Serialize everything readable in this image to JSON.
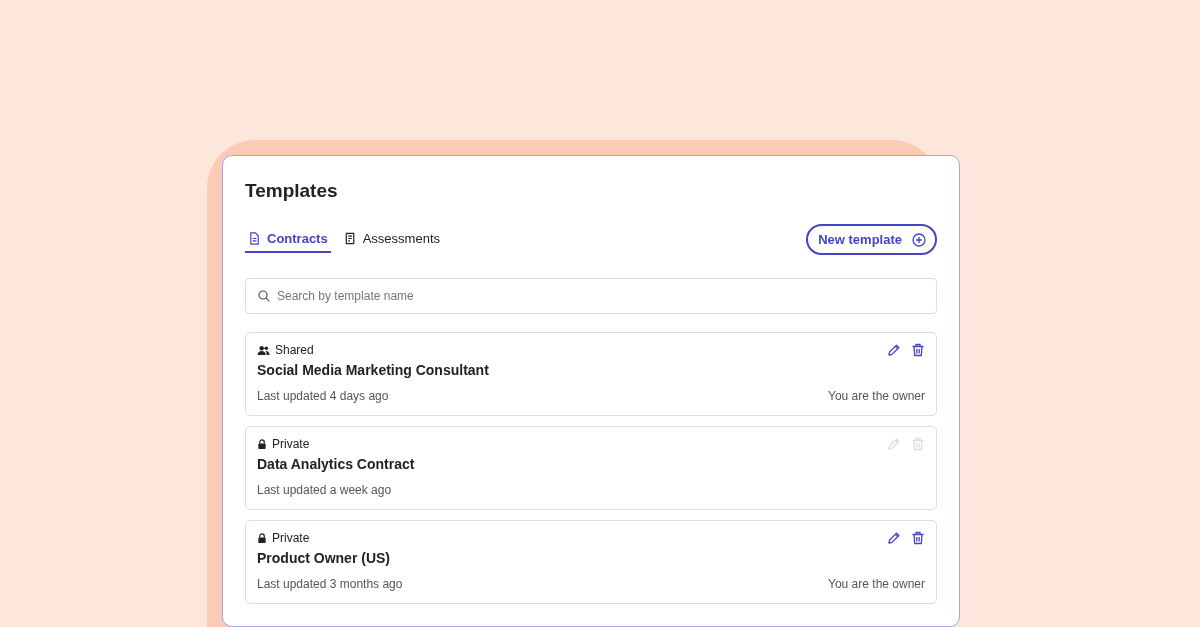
{
  "title": "Templates",
  "tabs": [
    {
      "label": "Contracts",
      "kind": "document",
      "selected": true
    },
    {
      "label": "Assessments",
      "kind": "checklist",
      "selected": false
    }
  ],
  "new_button": {
    "label": "New template"
  },
  "search": {
    "placeholder": "Search by template name"
  },
  "templates": [
    {
      "visibility": "Shared",
      "kind": "shared",
      "name": "Social Media Marketing Consultant",
      "updated": "Last updated 4 days ago",
      "owner_note": "You are the owner",
      "disabled": false
    },
    {
      "visibility": "Private",
      "kind": "private",
      "name": "Data Analytics Contract",
      "updated": "Last updated a week ago",
      "disabled": true
    },
    {
      "visibility": "Private",
      "kind": "private",
      "name": "Product Owner (US)",
      "updated": "Last updated 3 months ago",
      "owner_note": "You are the owner",
      "disabled": false
    }
  ]
}
